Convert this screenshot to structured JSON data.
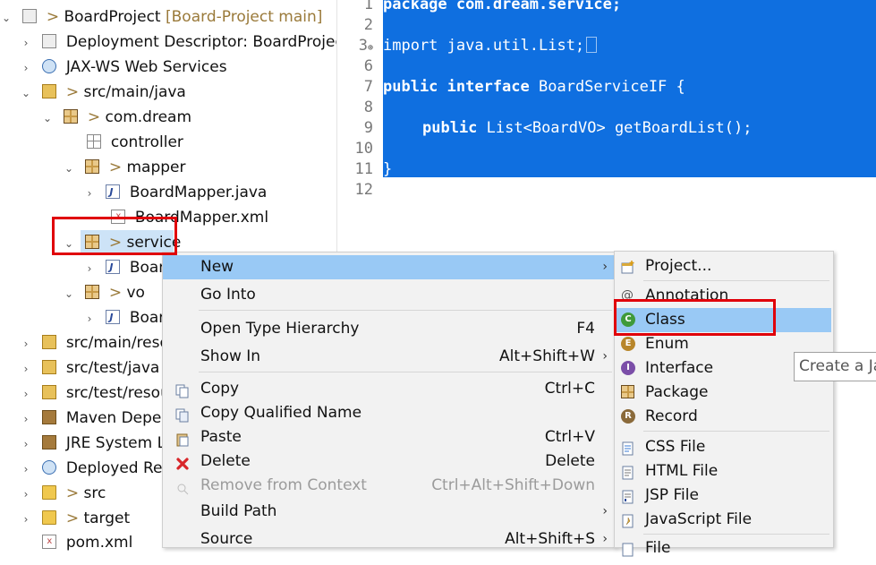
{
  "tree": {
    "items": [
      {
        "label": "BoardProject",
        "suffix": "[Board-Project main]"
      },
      {
        "label": "Deployment Descriptor: BoardProject"
      },
      {
        "label": "JAX-WS Web Services"
      },
      {
        "label": "src/main/java"
      },
      {
        "label": "com.dream"
      },
      {
        "label": "controller"
      },
      {
        "label": "mapper"
      },
      {
        "label": "BoardMapper.java"
      },
      {
        "label": "BoardMapper.xml"
      },
      {
        "label": "service"
      },
      {
        "label": "Board"
      },
      {
        "label": "vo"
      },
      {
        "label": "Board"
      },
      {
        "label": "src/main/resou"
      },
      {
        "label": "src/test/java"
      },
      {
        "label": "src/test/resour"
      },
      {
        "label": "Maven Depen"
      },
      {
        "label": "JRE System Lib"
      },
      {
        "label": "Deployed Res"
      },
      {
        "label": "src"
      },
      {
        "label": "target"
      },
      {
        "label": "pom.xml"
      }
    ],
    "decorator": ">",
    "expanded_glyph": "⌄",
    "collapsed_glyph": "›"
  },
  "editor": {
    "line_numbers": [
      "1",
      "2",
      "3",
      "6",
      "7",
      "8",
      "9",
      "10",
      "11",
      "12"
    ],
    "fold_marker": "⊕",
    "lines": {
      "l1": "package com.dream.service;",
      "l3": "import java.util.List;",
      "l7_kw": "public interface",
      "l7_rest": " BoardServiceIF {",
      "l9_kw": "public",
      "l9_rest": " List<BoardVO> getBoardList();",
      "l11": "}"
    },
    "selection_color": "#0f6fe0"
  },
  "context_menu": {
    "items": [
      {
        "label": "New",
        "shortcut": "",
        "submenu": true
      },
      {
        "label": "Go Into",
        "shortcut": ""
      },
      {
        "label": "Open Type Hierarchy",
        "shortcut": "F4"
      },
      {
        "label": "Show In",
        "shortcut": "Alt+Shift+W",
        "submenu": true
      },
      {
        "label": "Copy",
        "shortcut": "Ctrl+C"
      },
      {
        "label": "Copy Qualified Name",
        "shortcut": ""
      },
      {
        "label": "Paste",
        "shortcut": "Ctrl+V"
      },
      {
        "label": "Delete",
        "shortcut": "Delete"
      },
      {
        "label": "Remove from Context",
        "shortcut": "Ctrl+Alt+Shift+Down",
        "disabled": true
      },
      {
        "label": "Build Path",
        "shortcut": "",
        "submenu": true
      },
      {
        "label": "Source",
        "shortcut": "Alt+Shift+S",
        "submenu": true
      }
    ],
    "arrow": "›",
    "highlight_color": "#99c9f5"
  },
  "submenu": {
    "items": [
      {
        "label": "Project..."
      },
      {
        "label": "Annotation"
      },
      {
        "label": "Class"
      },
      {
        "label": "Enum"
      },
      {
        "label": "Interface"
      },
      {
        "label": "Package"
      },
      {
        "label": "Record"
      },
      {
        "label": "CSS File"
      },
      {
        "label": "HTML File"
      },
      {
        "label": "JSP File"
      },
      {
        "label": "JavaScript File"
      },
      {
        "label": "File"
      }
    ]
  },
  "tooltip": {
    "text": "Create a Ja"
  },
  "annotation_color": "#e0000a"
}
